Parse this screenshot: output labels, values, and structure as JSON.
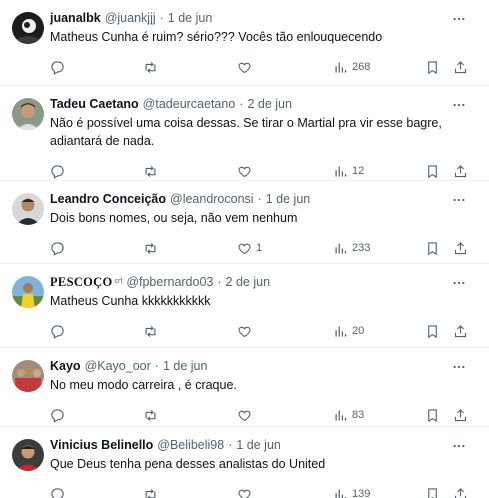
{
  "colors": {
    "text": "#0f1419",
    "muted": "#536471",
    "divider": "#eff3f4"
  },
  "tweets": [
    {
      "name": "juanalbk",
      "handle": "@juankjjj",
      "sep": "·",
      "date": "1 de jun",
      "text": "Matheus Cunha é ruim? sério??? Vocês tão enlouquecendo",
      "reply_count": "",
      "retweet_count": "",
      "like_count": "",
      "views": "268",
      "avatar_icon": "avatar-dark"
    },
    {
      "name": "Tadeu Caetano",
      "handle": "@tadeurcaetano",
      "sep": "·",
      "date": "2 de jun",
      "text": "Não é possível uma coisa dessas. Se tirar o Martial pra vir esse bagre, adiantará de nada.",
      "reply_count": "",
      "retweet_count": "",
      "like_count": "",
      "views": "12",
      "avatar_icon": "avatar-face"
    },
    {
      "name": "Leandro Conceição",
      "handle": "@leandroconsi",
      "sep": "·",
      "date": "1 de jun",
      "text": "Dois bons nomes, ou seja, não vem nenhum",
      "reply_count": "",
      "retweet_count": "",
      "like_count": "1",
      "views": "233",
      "avatar_icon": "avatar-man"
    },
    {
      "name": "PESCOÇO",
      "name_suffix": "crf",
      "handle": "@fpbernardo03",
      "sep": "·",
      "date": "2 de jun",
      "text": "Matheus Cunha kkkkkkkkkkk",
      "reply_count": "",
      "retweet_count": "",
      "like_count": "",
      "views": "20",
      "avatar_icon": "avatar-sky"
    },
    {
      "name": "Kayo",
      "handle": "@Kayo_oor",
      "sep": "·",
      "date": "1 de jun",
      "text": "No meu modo carreira , é craque.",
      "reply_count": "",
      "retweet_count": "",
      "like_count": "",
      "views": "83",
      "avatar_icon": "avatar-group"
    },
    {
      "name": "Vinicius Belinello",
      "handle": "@Belibeli98",
      "sep": "·",
      "date": "1 de jun",
      "text": "Que Deus tenha pena desses analistas do United",
      "reply_count": "",
      "retweet_count": "",
      "like_count": "",
      "views": "139",
      "avatar_icon": "avatar-red"
    }
  ]
}
